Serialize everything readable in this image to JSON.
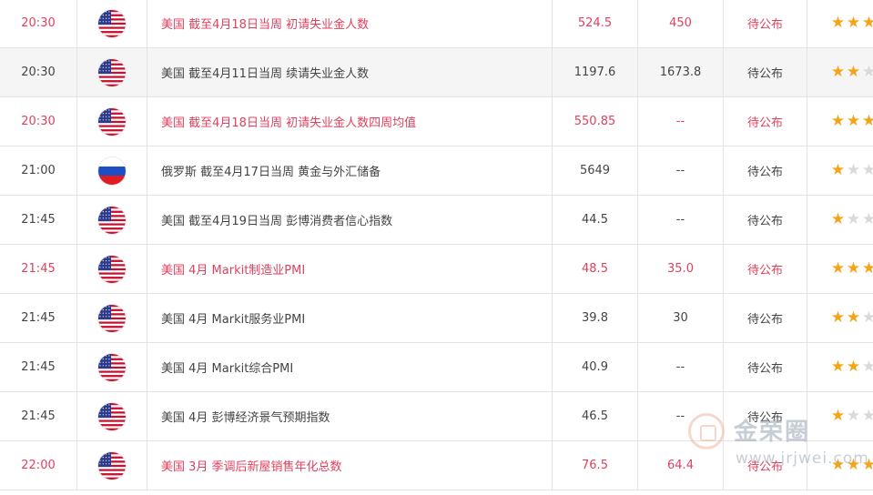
{
  "rows": [
    {
      "time": "20:30",
      "country": "us",
      "event": "美国 截至4月18日当周 初请失业金人数",
      "previous": "524.5",
      "forecast": "450",
      "actual": "待公布",
      "stars": 3,
      "important": true,
      "alt": false
    },
    {
      "time": "20:30",
      "country": "us",
      "event": "美国 截至4月11日当周 续请失业金人数",
      "previous": "1197.6",
      "forecast": "1673.8",
      "actual": "待公布",
      "stars": 2,
      "important": false,
      "alt": true
    },
    {
      "time": "20:30",
      "country": "us",
      "event": "美国 截至4月18日当周 初请失业金人数四周均值",
      "previous": "550.85",
      "forecast": "--",
      "actual": "待公布",
      "stars": 3,
      "important": true,
      "alt": false
    },
    {
      "time": "21:00",
      "country": "ru",
      "event": "俄罗斯 截至4月17日当周 黄金与外汇储备",
      "previous": "5649",
      "forecast": "--",
      "actual": "待公布",
      "stars": 1,
      "important": false,
      "alt": false
    },
    {
      "time": "21:45",
      "country": "us",
      "event": "美国 截至4月19日当周 彭博消费者信心指数",
      "previous": "44.5",
      "forecast": "--",
      "actual": "待公布",
      "stars": 1,
      "important": false,
      "alt": false
    },
    {
      "time": "21:45",
      "country": "us",
      "event": "美国 4月 Markit制造业PMI",
      "previous": "48.5",
      "forecast": "35.0",
      "actual": "待公布",
      "stars": 3,
      "important": true,
      "alt": false
    },
    {
      "time": "21:45",
      "country": "us",
      "event": "美国 4月 Markit服务业PMI",
      "previous": "39.8",
      "forecast": "30",
      "actual": "待公布",
      "stars": 2,
      "important": false,
      "alt": false
    },
    {
      "time": "21:45",
      "country": "us",
      "event": "美国 4月 Markit综合PMI",
      "previous": "40.9",
      "forecast": "--",
      "actual": "待公布",
      "stars": 2,
      "important": false,
      "alt": false
    },
    {
      "time": "21:45",
      "country": "us",
      "event": "美国 4月 彭博经济景气预期指数",
      "previous": "46.5",
      "forecast": "--",
      "actual": "待公布",
      "stars": 1,
      "important": false,
      "alt": false
    },
    {
      "time": "22:00",
      "country": "us",
      "event": "美国 3月 季调后新屋销售年化总数",
      "previous": "76.5",
      "forecast": "64.4",
      "actual": "待公布",
      "stars": 3,
      "important": true,
      "alt": false
    }
  ],
  "colors": {
    "important": "#e0415e",
    "normal": "#444444",
    "star_on": "#f3a417",
    "star_off": "#d9d9d9"
  },
  "watermark": {
    "name": "金荣圈",
    "url": "www.jrjwei.com"
  }
}
